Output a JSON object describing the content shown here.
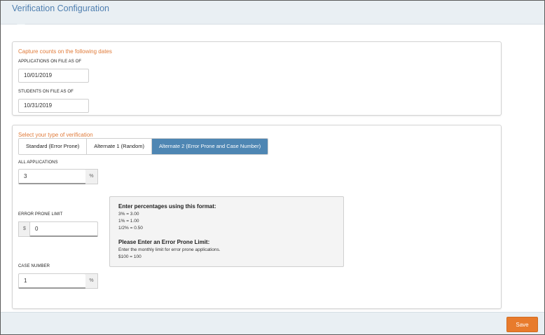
{
  "header": {
    "title": "Verification Configuration"
  },
  "capture": {
    "title": "Capture counts on the following dates",
    "applications_label": "APPLICATIONS ON FILE AS OF",
    "applications_value": "10/01/2019",
    "students_label": "STUDENTS ON FILE AS OF",
    "students_value": "10/31/2019"
  },
  "verification": {
    "title": "Select your type of verification",
    "tabs": [
      {
        "label": "Standard (Error Prone)",
        "active": false
      },
      {
        "label": "Alternate 1 (Random)",
        "active": false
      },
      {
        "label": "Alternate 2 (Error Prone and Case Number)",
        "active": true
      }
    ],
    "all_applications_label": "ALL APPLICATIONS",
    "all_applications_value": "3",
    "all_applications_suffix": "%",
    "error_prone_label": "ERROR PRONE LIMIT",
    "error_prone_prefix": "$",
    "error_prone_value": "0",
    "case_number_label": "CASE NUMBER",
    "case_number_value": "1",
    "case_number_suffix": "%"
  },
  "info": {
    "heading1": "Enter percentages using this format:",
    "lines1": [
      "3% = 3.00",
      "1% = 1.00",
      "1/2% = 0.50"
    ],
    "heading2": "Please Enter an Error Prone Limit:",
    "lines2": [
      "Enter the monthly limit for error prone applications.",
      "$100 = 100"
    ]
  },
  "footer": {
    "save_label": "Save"
  },
  "colors": {
    "accent": "#4e86b3",
    "section_title": "#e07b3a",
    "save": "#e87b2c"
  }
}
